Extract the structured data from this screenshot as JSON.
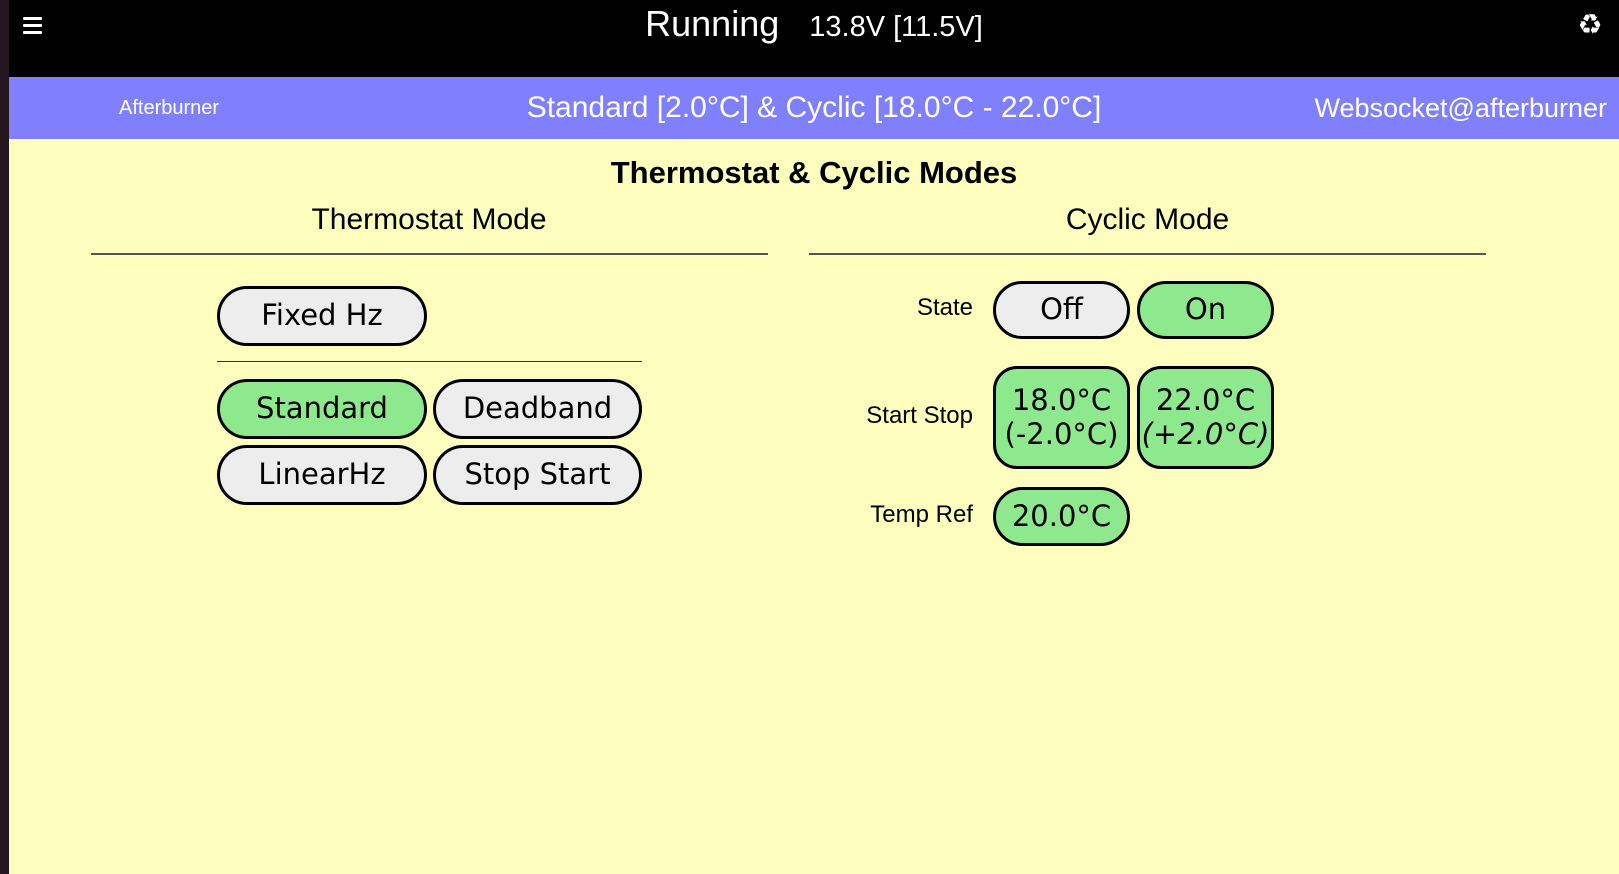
{
  "topbar": {
    "state": "Running",
    "voltage": "13.8V [11.5V]",
    "menu_icon": "hamburger-menu-icon",
    "right_icon": "recycle-icon",
    "right_icon_glyph": "♻"
  },
  "infobar": {
    "host": "Afterburner",
    "summary": "Standard [2.0°C] & Cyclic [18.0°C - 22.0°C]",
    "connection": "Websocket@afterburner"
  },
  "page": {
    "title": "Thermostat & Cyclic Modes"
  },
  "thermostat": {
    "title": "Thermostat Mode",
    "fixed": "Fixed Hz",
    "modes": [
      "Standard",
      "Deadband",
      "LinearHz",
      "Stop Start"
    ],
    "selected": "Standard"
  },
  "cyclic": {
    "title": "Cyclic Mode",
    "state_label": "State",
    "state_off": "Off",
    "state_on": "On",
    "state_selected": "On",
    "startstop_label": "Start Stop",
    "start_temp": "18.0°C",
    "start_delta": "(-2.0°C)",
    "stop_temp": "22.0°C",
    "stop_delta": "(+2.0°C)",
    "tempref_label": "Temp Ref",
    "tempref_value": "20.0°C"
  },
  "colors": {
    "topbar_bg": "#000000",
    "infobar_bg": "#8080ff",
    "page_bg": "#fdfdbd",
    "button_on": "#8ee88e",
    "button_off": "#ededed"
  }
}
